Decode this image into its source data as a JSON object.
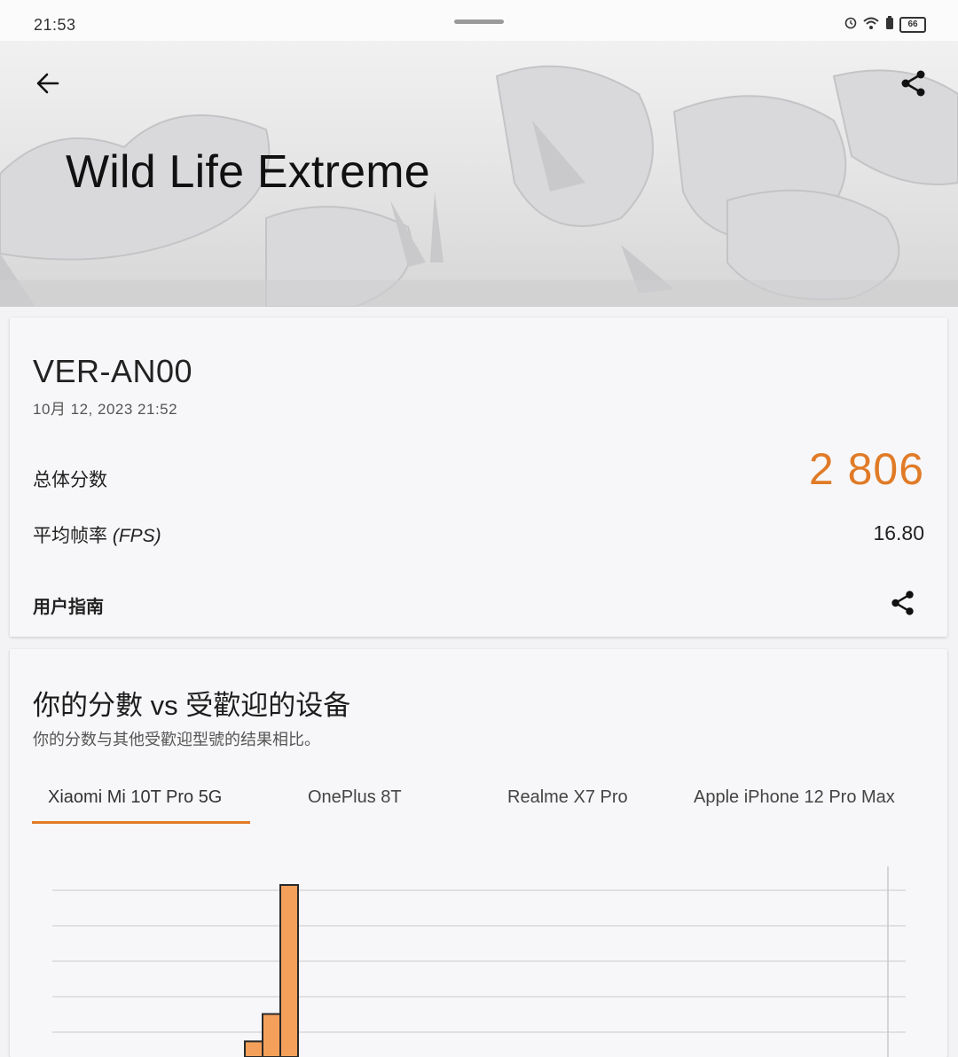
{
  "status_bar": {
    "time": "21:53",
    "battery": "66",
    "icons": [
      "alarm-icon",
      "wifi-icon",
      "battery-saver-icon",
      "battery-icon"
    ]
  },
  "header": {
    "title": "Wild Life Extreme",
    "back_icon": "arrow-left-icon",
    "share_icon": "share-icon"
  },
  "result": {
    "device": "VER-AN00",
    "date": "10月 12, 2023 21:52",
    "score_label": "总体分数",
    "score_value": "2 806",
    "fps_label": "平均帧率",
    "fps_unit": "(FPS)",
    "fps_value": "16.80",
    "guide_label": "用户指南",
    "accent_color": "#e07b27"
  },
  "comparison": {
    "title": "你的分數 vs 受歡迎的设备",
    "subtitle": "你的分数与其他受歡迎型號的结果相比。",
    "tabs": [
      {
        "label": "Xiaomi Mi 10T Pro 5G",
        "active": true
      },
      {
        "label": "OnePlus 8T",
        "active": false
      },
      {
        "label": "Realme X7 Pro",
        "active": false
      },
      {
        "label": "Apple iPhone 12 Pro Max",
        "active": false
      }
    ]
  },
  "chart_data": {
    "type": "bar",
    "grid": true,
    "bar_color": "#f5a05a",
    "values": [
      0.04,
      0.11,
      0.44
    ]
  }
}
